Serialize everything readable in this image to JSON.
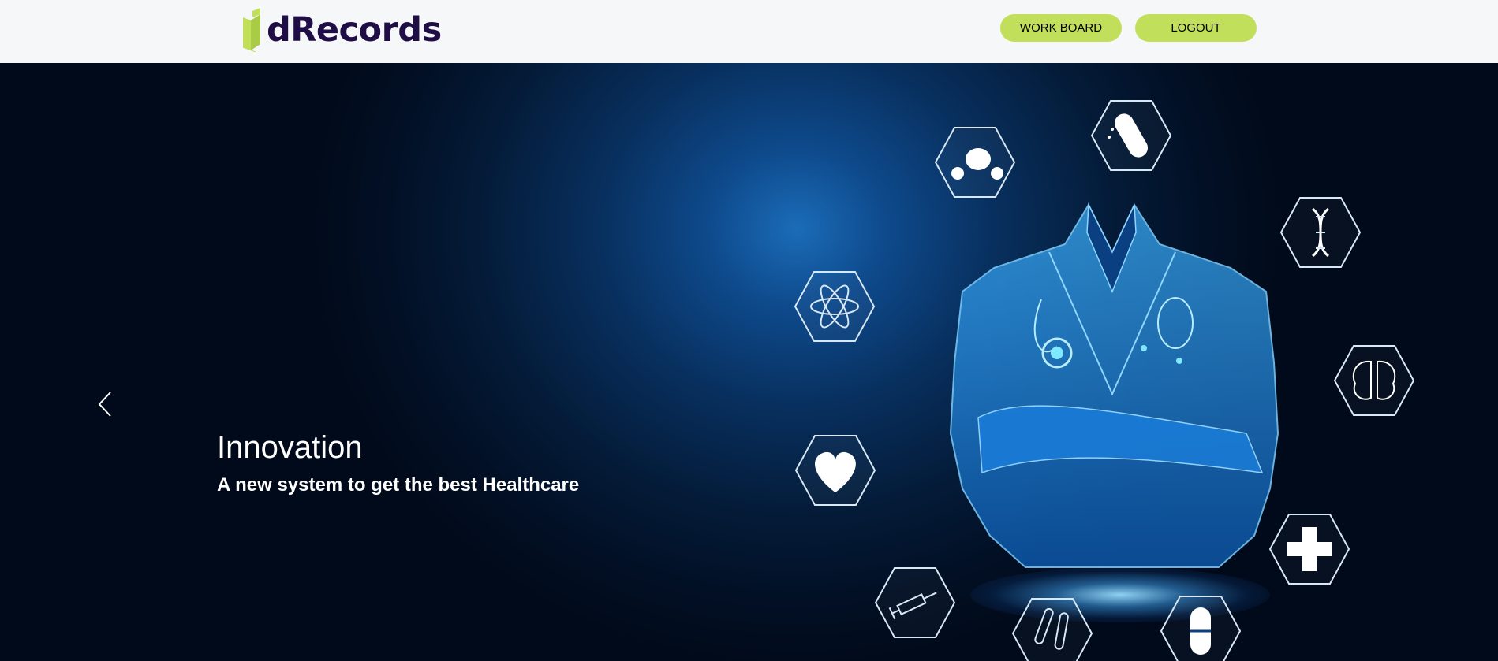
{
  "header": {
    "logo_text": "dRecords",
    "work_board_label": "WORK BOARD",
    "logout_label": "LOGOUT"
  },
  "carousel": {
    "title": "Innovation",
    "subtitle": "A new system to get the best Healthcare",
    "prev_icon": "chevron-left-icon",
    "hex_icons": [
      "pills-icon",
      "capsule-icon",
      "dna-icon",
      "atom-icon",
      "brain-icon",
      "heart-icon",
      "medical-cross-icon",
      "syringe-icon",
      "test-tube-icon",
      "pill-icon"
    ]
  },
  "colors": {
    "accent": "#c2df5b",
    "brand_text": "#1e0e45",
    "header_bg": "#f6f7f9",
    "hero_bg": "#010c1c"
  }
}
